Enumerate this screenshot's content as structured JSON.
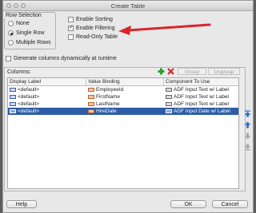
{
  "window": {
    "title": "Create Table"
  },
  "row_selection": {
    "legend": "Row Selection",
    "options": [
      {
        "label": "None",
        "selected": false
      },
      {
        "label": "Single Row",
        "selected": true
      },
      {
        "label": "Multiple Rows",
        "selected": false
      }
    ]
  },
  "options": {
    "enable_sorting": {
      "label": "Enable Sorting",
      "checked": false
    },
    "enable_filtering": {
      "label": "Enable Filtering",
      "checked": true
    },
    "read_only": {
      "label": "Read-Only Table",
      "checked": false
    },
    "generate_columns": {
      "label": "Generate columns dynamically at runtime",
      "checked": false
    }
  },
  "columns": {
    "label": "Columns:",
    "group_label": "Group",
    "ungroup_label": "Ungroup",
    "headers": [
      "Display Label",
      "Value Binding",
      "Component To Use"
    ],
    "rows": [
      {
        "display_label": "<default>",
        "value_binding": "EmployeeId",
        "component": "ADF Input Text w/ Label",
        "selected": false
      },
      {
        "display_label": "<default>",
        "value_binding": "FirstName",
        "component": "ADF Input Text w/ Label",
        "selected": false
      },
      {
        "display_label": "<default>",
        "value_binding": "LastName",
        "component": "ADF Input Text w/ Label",
        "selected": false
      },
      {
        "display_label": "<default>",
        "value_binding": "HireDate",
        "component": "ADF Input Date w/ Label",
        "selected": true
      }
    ]
  },
  "footer": {
    "help": "Help",
    "ok": "OK",
    "cancel": "Cancel"
  },
  "colors": {
    "selection": "#2d5da6",
    "arrow": "#d9262c",
    "add": "#2f9e33",
    "delete": "#d02a2a"
  }
}
